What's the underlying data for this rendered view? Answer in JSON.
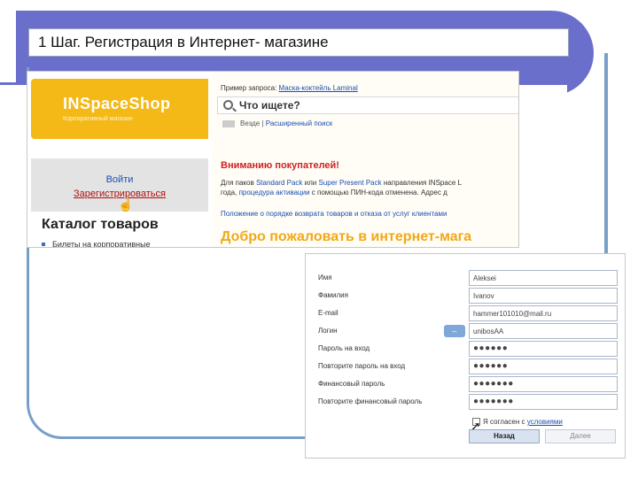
{
  "title": "1 Шаг. Регистрация в Интернет- магазине",
  "shop": {
    "logo": "INSpaceShop",
    "logo_subtitle": "Корпоративный магазин",
    "login_label": "Войти",
    "register_label": "Зарегистрироваться",
    "catalog_title": "Каталог товаров",
    "catalog_item": "Билеты на корпоративные",
    "search_example_prefix": "Пример запроса:",
    "search_example_link": "Маска-коктейль Laminal",
    "search_placeholder": "Что ищете?",
    "search_scope": "Везде",
    "search_advanced": "Расширенный поиск",
    "attention_title": "Вниманию покупателей!",
    "notice_part1": "Для паков ",
    "notice_link1": "Standard Pack",
    "notice_part2": " или ",
    "notice_link2": "Super Present Pack",
    "notice_part3": " направления INSpace L",
    "notice_part4": "года, ",
    "notice_link3": "процедура активации",
    "notice_part5": " с помощью ПИН-кода отменена. Адрес д",
    "policy_text": "Положение о порядке возврата товаров и отказа от услуг клиентами",
    "welcome_text": "Добро пожаловать в интернет-мага"
  },
  "form": {
    "fields": [
      {
        "label": "Имя",
        "value": "Aleksei"
      },
      {
        "label": "Фамилия",
        "value": "Ivanov"
      },
      {
        "label": "E-mail",
        "value": "hammer101010@mail.ru"
      },
      {
        "label": "Логин",
        "value": "unibosAA"
      },
      {
        "label": "Пароль на вход",
        "value": "●●●●●●"
      },
      {
        "label": "Повторите пароль на вход",
        "value": "●●●●●●"
      },
      {
        "label": "Финансовый пароль",
        "value": "●●●●●●●"
      },
      {
        "label": "Повторите финансовый пароль",
        "value": "●●●●●●●"
      }
    ],
    "agree_prefix": "Я согласен с ",
    "agree_link": "условиями",
    "back_button": "Назад",
    "next_button": "Далее"
  }
}
